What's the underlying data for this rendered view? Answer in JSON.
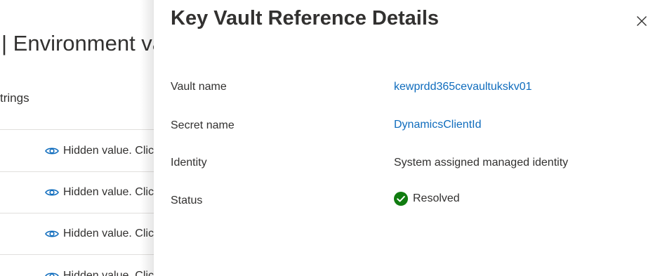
{
  "background": {
    "page_title": "| Environment va",
    "tab_label": "trings",
    "rows": [
      {
        "value_text": "Hidden value. Clic"
      },
      {
        "value_text": "Hidden value. Clic"
      },
      {
        "value_text": "Hidden value. Clic"
      },
      {
        "value_text": "Hidden value. Clic"
      }
    ]
  },
  "panel": {
    "title": "Key Vault Reference Details",
    "close_icon": "close-icon",
    "fields": {
      "vault_name": {
        "label": "Vault name",
        "value": "kewprdd365cevaultukskv01"
      },
      "secret_name": {
        "label": "Secret name",
        "value": "DynamicsClientId"
      },
      "identity": {
        "label": "Identity",
        "value": "System assigned managed identity"
      },
      "status": {
        "label": "Status",
        "value": "Resolved"
      }
    }
  },
  "colors": {
    "link": "#0f6cbd",
    "success": "#107c10",
    "eye_icon": "#0f6cbd"
  }
}
